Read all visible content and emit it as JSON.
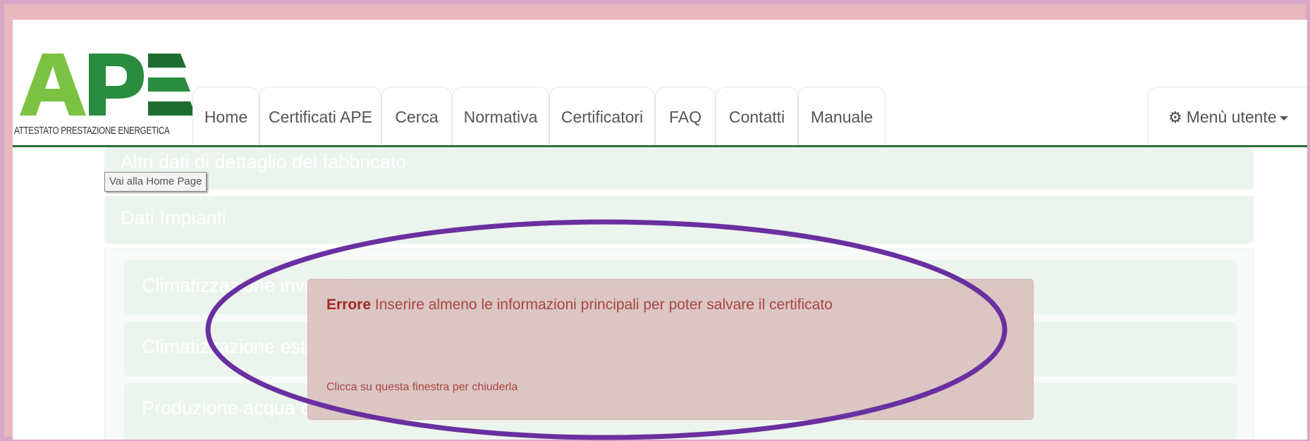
{
  "logo": {
    "letters": "APE",
    "subtitle": "ATTESTATO PRESTAZIONE ENERGETICA",
    "colors": {
      "light_green": "#7cc242",
      "dark_green": "#2a8c3e",
      "darker_green": "#1f6d31"
    }
  },
  "nav": {
    "tabs": [
      "Home",
      "Certificati APE",
      "Cerca",
      "Normativa",
      "Certificatori",
      "FAQ",
      "Contatti",
      "Manuale"
    ],
    "user_menu": "Menù utente",
    "accent": "#2e6e3a"
  },
  "tooltip": "Vai alla Home Page",
  "panels": {
    "altri_dati": "Altri dati di dettaglio del fabbricato",
    "dati_impianti": "Dati Impianti",
    "sub": [
      "Climatizzazione invernale",
      "Climatizzazione estiva",
      "Produzione acqua calda sanitaria"
    ]
  },
  "error": {
    "title": "Errore",
    "message": "Inserire almeno le informazioni principali per poter salvare il certificato",
    "hint": "Clicca su questa finestra per chiuderla",
    "color": "#a94442"
  },
  "annotation": {
    "ellipse_color": "#6a2fa0"
  }
}
